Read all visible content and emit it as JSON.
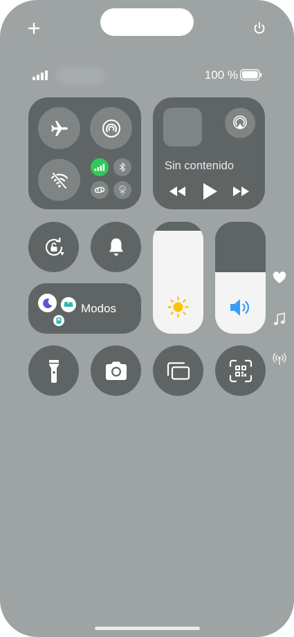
{
  "status": {
    "battery_text": "100 %"
  },
  "media": {
    "no_content_label": "Sin contenido"
  },
  "focus": {
    "label": "Modos"
  },
  "sliders": {
    "brightness_level": 0.92,
    "volume_level": 0.55
  },
  "icons": {
    "top_left": "plus-icon",
    "top_right": "power-icon",
    "airplane": "airplane-icon",
    "airdrop": "airdrop-icon",
    "wifi_off": "wifi-off-icon",
    "cellular": "cellular-icon",
    "bluetooth": "bluetooth-icon",
    "hotspot": "hotspot-icon",
    "vpn": "vpn-icon",
    "airplay": "airplay-icon",
    "rotation_lock": "rotation-lock-icon",
    "bell": "bell-icon",
    "sun": "sun-icon",
    "speaker": "speaker-icon",
    "flashlight": "flashlight-icon",
    "camera": "camera-icon",
    "screen_mirroring": "screen-mirroring-icon",
    "code_scanner": "qr-scanner-icon",
    "heart": "heart-icon",
    "music": "music-note-icon",
    "signal_side": "signal-icon"
  },
  "colors": {
    "background": "#9ea3a3",
    "tile": "#5f6565",
    "cellular_active": "#30c85a",
    "focus_moon": "#5856d6",
    "focus_bed": "#2fb7b0",
    "sun": "#ffc400",
    "speaker": "#3b9cf5"
  }
}
